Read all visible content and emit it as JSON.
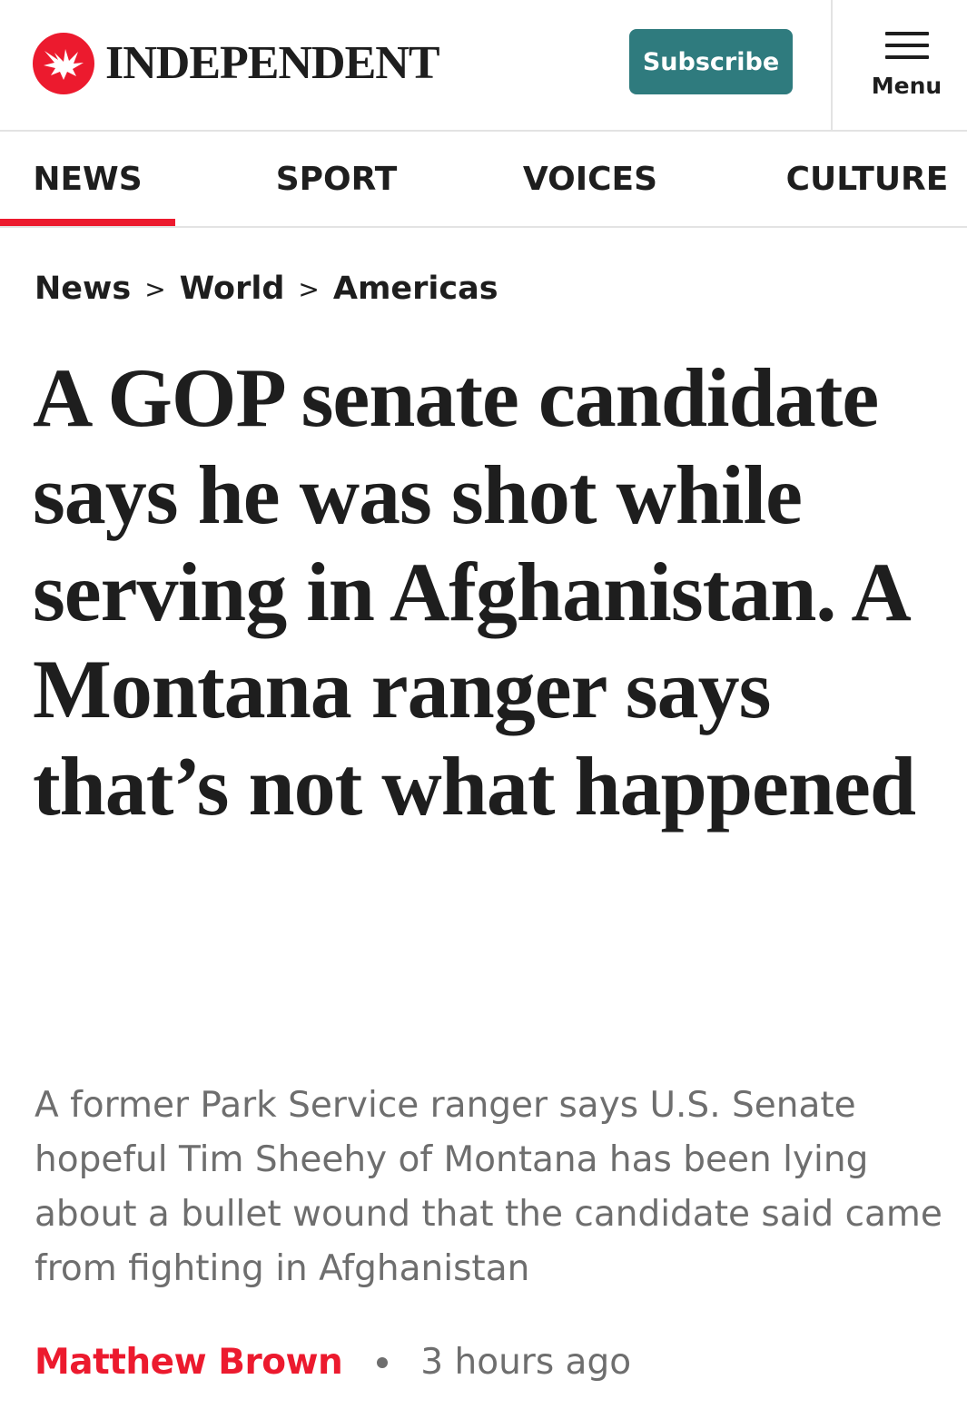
{
  "header": {
    "logo_text": "INDEPENDENT",
    "logo_icon": "eagle-icon",
    "subscribe_label": "Subscribe",
    "menu_label": "Menu"
  },
  "nav": {
    "items": [
      {
        "label": "NEWS",
        "active": true
      },
      {
        "label": "SPORT",
        "active": false
      },
      {
        "label": "VOICES",
        "active": false
      },
      {
        "label": "CULTURE",
        "active": false
      }
    ]
  },
  "breadcrumb": {
    "items": [
      "News",
      "World",
      "Americas"
    ],
    "separator": ">"
  },
  "article": {
    "headline": "A GOP senate candidate says he was shot while serving in Afghanistan. A Montana ranger says that’s not what happened",
    "standfirst": "A former Park Service ranger says U.S. Senate hopeful Tim Sheehy of Montana has been lying about a bullet wound that the candidate said came from fighting in Afghanistan",
    "author": "Matthew Brown",
    "time": "3 hours ago"
  },
  "colors": {
    "brand_red": "#ec1a2e",
    "subscribe_teal": "#2f7b7e",
    "text_dark": "#1e1e1e",
    "text_gray": "#6e6e6e"
  }
}
